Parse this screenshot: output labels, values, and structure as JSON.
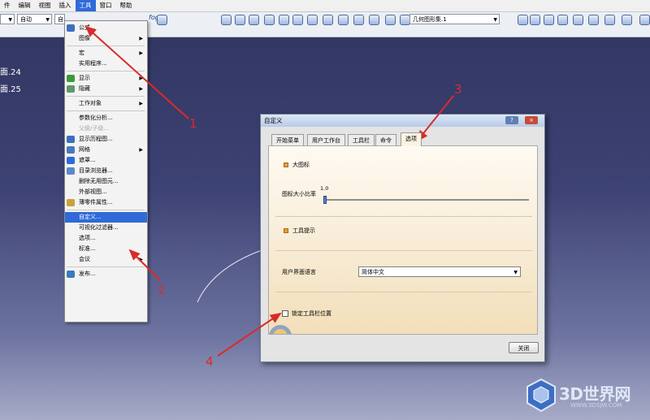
{
  "menubar": {
    "items": [
      "件",
      "编辑",
      "视图",
      "插入",
      "工具",
      "窗口",
      "帮助"
    ],
    "active_index": 4
  },
  "toolbar": {
    "combo1": "",
    "combo2": "自动",
    "combo3": "自",
    "geo_set": "几何图形集.1",
    "formula_label": "fog"
  },
  "tree": [
    "面.24",
    "面.25"
  ],
  "tools_menu": {
    "items": [
      {
        "label": "公式...",
        "submenu": false,
        "state": "normal",
        "icon": "formula-icon"
      },
      {
        "label": "图像",
        "submenu": true,
        "state": "normal",
        "icon": ""
      },
      {
        "sep": true
      },
      {
        "label": "宏",
        "submenu": true,
        "state": "normal",
        "icon": ""
      },
      {
        "label": "实用程序...",
        "submenu": false,
        "state": "normal",
        "icon": ""
      },
      {
        "sep": true
      },
      {
        "label": "显示",
        "submenu": true,
        "state": "normal",
        "icon": "show-icon"
      },
      {
        "label": "隐藏",
        "submenu": true,
        "state": "normal",
        "icon": "hide-icon"
      },
      {
        "sep": true
      },
      {
        "label": "工作对象",
        "submenu": true,
        "state": "normal",
        "icon": ""
      },
      {
        "sep": true
      },
      {
        "label": "参数化分析...",
        "submenu": false,
        "state": "normal",
        "icon": ""
      },
      {
        "label": "父级/子级...",
        "submenu": false,
        "state": "disabled",
        "icon": ""
      },
      {
        "label": "显示历程图...",
        "submenu": false,
        "state": "normal",
        "icon": "history-icon"
      },
      {
        "label": "网格",
        "submenu": true,
        "state": "normal",
        "icon": "grid-icon"
      },
      {
        "label": "遮罩...",
        "submenu": false,
        "state": "normal",
        "icon": "mask-icon"
      },
      {
        "label": "目录浏览器...",
        "submenu": false,
        "state": "normal",
        "icon": "catalog-icon"
      },
      {
        "label": "删除无用图元...",
        "submenu": false,
        "state": "normal",
        "icon": ""
      },
      {
        "label": "外部视图...",
        "submenu": false,
        "state": "normal",
        "icon": ""
      },
      {
        "label": "薄零件属性...",
        "submenu": false,
        "state": "normal",
        "icon": "thin-part-icon"
      },
      {
        "sep": true
      },
      {
        "label": "自定义...",
        "submenu": false,
        "state": "highlighted",
        "icon": ""
      },
      {
        "label": "可视化过滤器...",
        "submenu": false,
        "state": "normal",
        "icon": ""
      },
      {
        "label": "选项...",
        "submenu": false,
        "state": "normal",
        "icon": ""
      },
      {
        "label": "标准...",
        "submenu": false,
        "state": "normal",
        "icon": ""
      },
      {
        "label": "会议",
        "submenu": true,
        "state": "normal",
        "icon": ""
      },
      {
        "sep": true
      },
      {
        "label": "发布...",
        "submenu": false,
        "state": "normal",
        "icon": "publish-icon"
      }
    ]
  },
  "dialog": {
    "title": "自定义",
    "help_btn": "?",
    "close_btn": "×",
    "tabs": [
      "开始菜单",
      "用户工作台",
      "工具栏",
      "命令",
      "选项"
    ],
    "selected_tab": 4,
    "large_icons_label": "大图标",
    "icon_ratio_label": "图标大小比率",
    "icon_ratio_value": "1.0",
    "icon_ratio_fraction": 0.0,
    "tooltips_label": "工具提示",
    "ui_language_label": "用户界面语言",
    "ui_language_value": "简体中文",
    "lock_toolbar_label": "锁定工具栏位置",
    "lock_toolbar_checked": false,
    "close_button": "关闭"
  },
  "annotations": [
    "1",
    "2",
    "3",
    "4"
  ],
  "watermark": {
    "brand": "3D世界网",
    "url": "WWW.3DSJW.COM"
  },
  "colors": {
    "highlight": "#2f6ad8",
    "annotation": "#d92b2b",
    "background": "#3d4274"
  }
}
